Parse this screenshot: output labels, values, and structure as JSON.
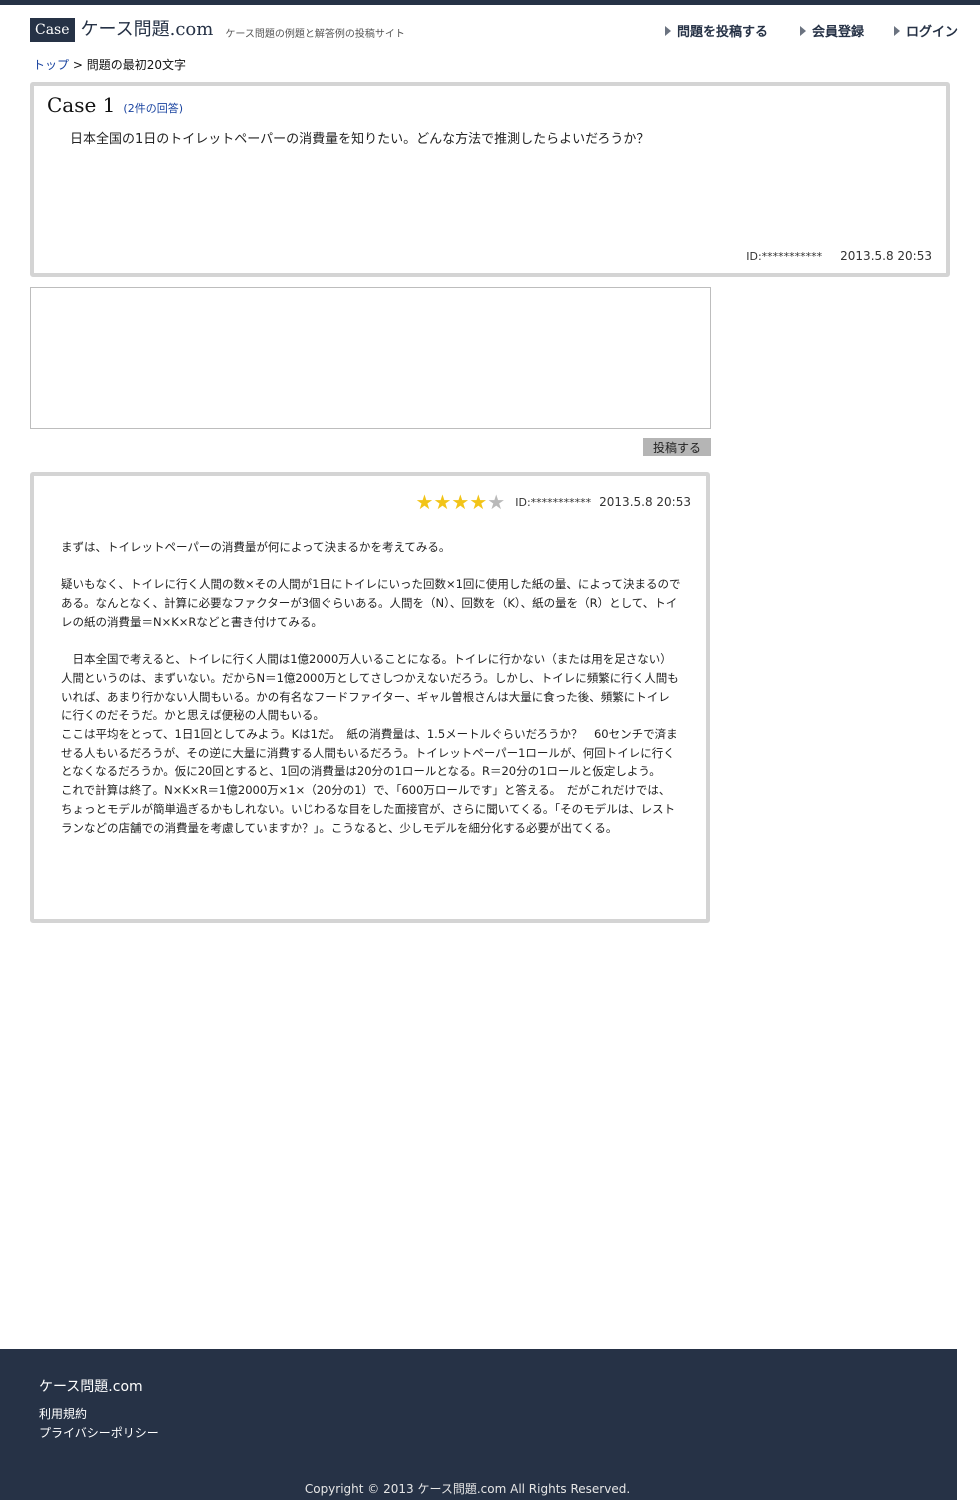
{
  "header": {
    "logo_case": "Case",
    "logo_name": "ケース問題.com",
    "tagline": "ケース問題の例題と解答例の投稿サイト",
    "nav": [
      {
        "label": "問題を投稿する"
      },
      {
        "label": "会員登録"
      },
      {
        "label": "ログイン"
      }
    ]
  },
  "breadcrumb": {
    "home": "トップ",
    "separator": " > ",
    "current": "問題の最初20文字"
  },
  "question": {
    "title": "Case 1",
    "answer_count": "(2件の回答)",
    "text": "日本全国の1日のトイレットペーパーの消費量を知りたい。どんな方法で推測したらよいだろうか？",
    "user_id": "ID:***********",
    "datetime": "2013.5.8  20:53"
  },
  "answer_form": {
    "placeholder": "",
    "submit_label": "投稿する"
  },
  "answer": {
    "rating": 4,
    "rating_max": 5,
    "user_id": "ID:***********",
    "datetime": "2013.5.8  20:53",
    "paragraphs": [
      "まずは、トイレットペーパーの消費量が何によって決まるかを考えてみる。",
      "疑いもなく、トイレに行く人間の数×その人間が1日にトイレにいった回数×1回に使用した紙の量、によって決まるのである。なんとなく、計算に必要なファクターが3個ぐらいある。人間を（N）、回数を（K）、紙の量を（R）として、トイレの紙の消費量＝N×K×Rなどと書き付けてみる。",
      "　日本全国で考えると、トイレに行く人間は1億2000万人いることになる。トイレに行かない（または用を足さない）人間というのは、まずいない。だからN＝1億2000万としてさしつかえないだろう。しかし、トイレに頻繁に行く人間もいれば、あまり行かない人間もいる。かの有名なフードファイター、ギャル曽根さんは大量に食った後、頻繁にトイレに行くのだそうだ。かと思えば便秘の人間もいる。",
      "ここは平均をとって、1日1回としてみよう。Kは1だ。　紙の消費量は、1.5メートルぐらいだろうか？　60センチで済ませる人もいるだろうが、その逆に大量に消費する人間もいるだろう。トイレットペーパー1ロールが、何回トイレに行くとなくなるだろうか。仮に20回とすると、1回の消費量は20分の1ロールとなる。R＝20分の1ロールと仮定しよう。",
      "これで計算は終了。N×K×R＝1億2000万×1×（20分の1）で、「600万ロールです」と答える。　だがこれだけでは、ちょっとモデルが簡単過ぎるかもしれない。いじわるな目をした面接官が、さらに聞いてくる。「そのモデルは、レストランなどの店舗での消費量を考慮していますか？」。こうなると、少しモデルを細分化する必要が出てくる。"
    ]
  },
  "footer": {
    "brand": "ケース問題.com",
    "links": [
      {
        "label": "利用規約"
      },
      {
        "label": "プライバシーポリシー"
      }
    ],
    "copyright": "Copyright © 2013 ケース問題.com All Rights Reserved."
  },
  "colors": {
    "navy": "#263246",
    "link": "#1a44a0",
    "star_on": "#f2c418",
    "star_off": "#b9b9b9",
    "card_border": "#d4d4d4"
  }
}
